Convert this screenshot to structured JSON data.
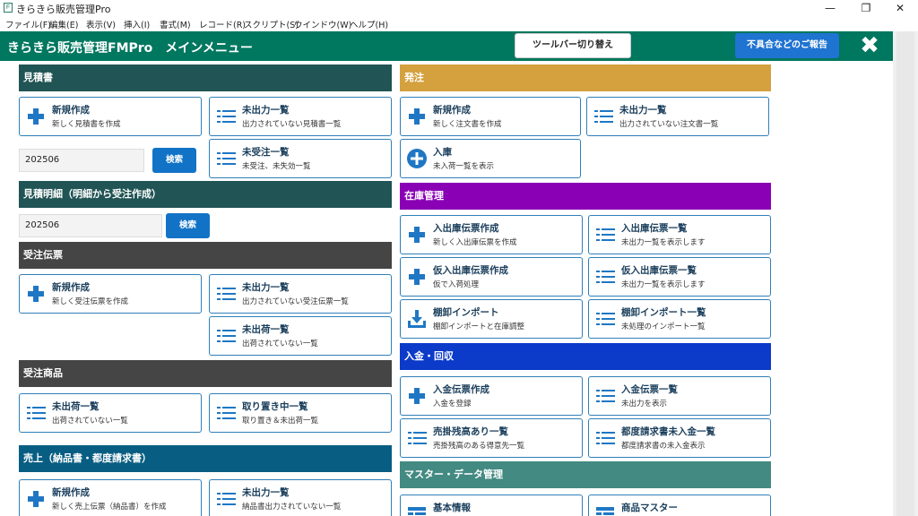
{
  "window": {
    "title": "きらきら販売管理Pro",
    "icon_letter": "F",
    "minimize_glyph": "—",
    "restore_glyph": "❐",
    "close_glyph": "✕"
  },
  "menu": [
    "ファイル(F)",
    "編集(E)",
    "表示(V)",
    "挿入(I)",
    "書式(M)",
    "レコード(R)",
    "スクリプト(S)",
    "ウインドウ(W)",
    "ヘルプ(H)"
  ],
  "header": {
    "title": "きらきら販売管理FMPro　メインメニュー",
    "toolbar_button": "ツールバー切り替え",
    "report_button": "不具合などのご報告",
    "close_glyph": "✖"
  },
  "colors": {
    "header": "#00775f",
    "mitsumori": "#215454",
    "juchu": "#454545",
    "uriage": "#085e82",
    "hacchu": "#d4a13e",
    "zaiko": "#8a00b5",
    "nyukin": "#0c3ac9",
    "master": "#428a82",
    "card_border": "#2f7fb8",
    "icon": "#1f77c4"
  },
  "left": {
    "mitsumori": {
      "label": "見積書",
      "new_title": "新規作成",
      "new_sub": "新しく見積書を作成",
      "unout_title": "未出力一覧",
      "unout_sub": "出力されていない見積書一覧",
      "unord_title": "未受注一覧",
      "unord_sub": "未受注、未失効一覧",
      "search_value": "202506",
      "search_button": "検索"
    },
    "meisai": {
      "label": "見積明細（明細から受注作成）",
      "search_value": "202506",
      "search_button": "検索"
    },
    "juchu": {
      "label": "受注伝票",
      "new_title": "新規作成",
      "new_sub": "新しく受注伝票を作成",
      "unout_title": "未出力一覧",
      "unout_sub": "出力されていない受注伝票一覧",
      "unship_title": "未出荷一覧",
      "unship_sub": "出荷されていない一覧"
    },
    "juchu_shohin": {
      "label": "受注商品",
      "unship_title": "未出荷一覧",
      "unship_sub": "出荷されていない一覧",
      "hold_title": "取り置き中一覧",
      "hold_sub": "取り置き＆未出荷一覧"
    },
    "uriage": {
      "label": "売上（納品書・都度請求書）",
      "new_title": "新規作成",
      "new_sub": "新しく売上伝票（納品書）を作成",
      "unout_title": "未出力一覧",
      "unout_sub": "納品書出力されていない一覧"
    }
  },
  "right": {
    "hacchu": {
      "label": "発注",
      "new_title": "新規作成",
      "new_sub": "新しく注文書を作成",
      "unout_title": "未出力一覧",
      "unout_sub": "出力されていない注文書一覧",
      "nyuko_title": "入庫",
      "nyuko_sub": "未入荷一覧を表示"
    },
    "zaiko": {
      "label": "在庫管理",
      "io_new_title": "入出庫伝票作成",
      "io_new_sub": "新しく入出庫伝票を作成",
      "io_list_title": "入出庫伝票一覧",
      "io_list_sub": "未出力一覧を表示します",
      "kari_new_title": "仮入出庫伝票作成",
      "kari_new_sub": "仮で入荷処理",
      "kari_list_title": "仮入出庫伝票一覧",
      "kari_list_sub": "未出力一覧を表示します",
      "tana_imp_title": "棚卸インポート",
      "tana_imp_sub": "棚卸インポートと在庫調整",
      "tana_list_title": "棚卸インポート一覧",
      "tana_list_sub": "未処理のインポート一覧"
    },
    "nyukin": {
      "label": "入金・回収",
      "new_title": "入金伝票作成",
      "new_sub": "入金を登録",
      "list_title": "入金伝票一覧",
      "list_sub": "未出力を表示",
      "zandaka_title": "売掛残高あり一覧",
      "zandaka_sub": "売掛残高のある得意先一覧",
      "tsudo_title": "都度請求書未入金一覧",
      "tsudo_sub": "都度請求書の未入金表示"
    },
    "master": {
      "label": "マスター・データ管理",
      "kihon_title": "基本情報",
      "shohin_title": "商品マスター"
    }
  }
}
